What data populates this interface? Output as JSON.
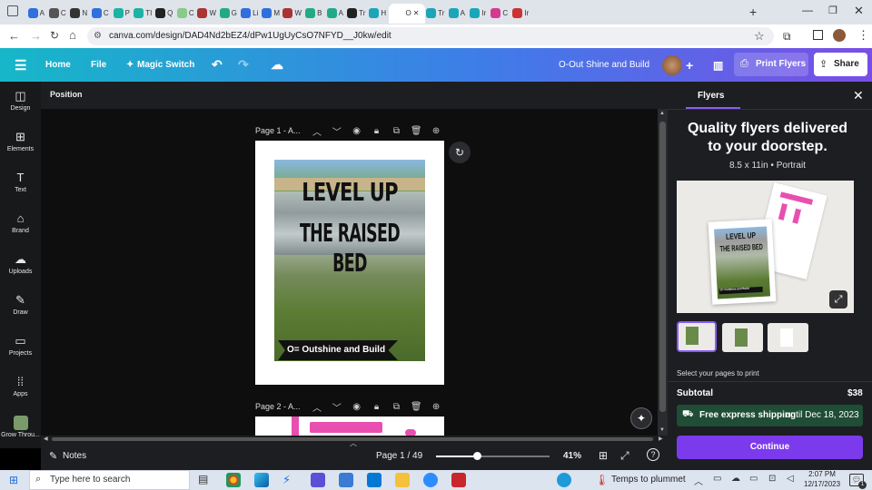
{
  "browser": {
    "tabs": [
      {
        "label": "A",
        "color": "#2f6fde"
      },
      {
        "label": "C",
        "color": "#555"
      },
      {
        "label": "N",
        "color": "#333"
      },
      {
        "label": "C",
        "color": "#2f6fde"
      },
      {
        "label": "P",
        "color": "#1ab3a6"
      },
      {
        "label": "TI",
        "color": "#1ab3a6"
      },
      {
        "label": "Q",
        "color": "#222"
      },
      {
        "label": "C",
        "color": "#8c8"
      },
      {
        "label": "W",
        "color": "#a33"
      },
      {
        "label": "G",
        "color": "#2a8"
      },
      {
        "label": "Li",
        "color": "#2f6fde"
      },
      {
        "label": "M",
        "color": "#2f6fde"
      },
      {
        "label": "W",
        "color": "#a33"
      },
      {
        "label": "B",
        "color": "#2a8"
      },
      {
        "label": "A",
        "color": "#2a8"
      },
      {
        "label": "Tr",
        "color": "#222"
      },
      {
        "label": "H",
        "color": "#1aa6b8"
      },
      {
        "label": "O",
        "color": "#fff"
      },
      {
        "label": "Tr",
        "color": "#1aa6b8"
      },
      {
        "label": "A",
        "color": "#1aa6b8"
      },
      {
        "label": "Ir",
        "color": "#1aa6b8"
      },
      {
        "label": "C",
        "color": "#d63a8e"
      },
      {
        "label": "Ir",
        "color": "#c33"
      }
    ],
    "active_tab_index": 17,
    "url": "canva.com/design/DAD4Nd2bEZ4/dPw1UgUyCsO7NFYD__J0kw/edit"
  },
  "canva": {
    "home": "Home",
    "file": "File",
    "magic_switch": "Magic Switch",
    "title": "O-Out Shine and Build",
    "print_flyers": "Print Flyers",
    "share": "Share",
    "position": "Position",
    "nav": [
      {
        "label": "Design",
        "icon": "◫"
      },
      {
        "label": "Elements",
        "icon": "⊞"
      },
      {
        "label": "Text",
        "icon": "T"
      },
      {
        "label": "Brand",
        "icon": "⌂"
      },
      {
        "label": "Uploads",
        "icon": "☁"
      },
      {
        "label": "Draw",
        "icon": "✎"
      },
      {
        "label": "Projects",
        "icon": "▭"
      },
      {
        "label": "Apps",
        "icon": "⁞⁞"
      },
      {
        "label": "Grow Throu..."
      }
    ],
    "page1_label": "Page 1 - A...",
    "page2_label": "Page 2 - A...",
    "design_line1": "LEVEL UP",
    "design_line2": "THE RAISED BED",
    "design_banner": "O= Outshine and Build",
    "notes": "Notes",
    "page_count": "Page 1 / 49",
    "zoom": "41%",
    "zoom_slider_fraction": 0.36
  },
  "panel": {
    "tab": "Flyers",
    "headline": "Quality flyers delivered to your doorstep.",
    "subhead": "8.5 x 11in • Portrait",
    "preview_line1": "LEVEL UP",
    "preview_line2": "THE RAISED BED",
    "preview_banner": "O= Outshine and Build",
    "select_pages": "Select your pages to print",
    "subtotal_label": "Subtotal",
    "subtotal_value": "$38",
    "shipping_bold": "Free express shipping",
    "shipping_rest": "until Dec 18, 2023",
    "continue": "Continue"
  },
  "taskbar": {
    "search_placeholder": "Type here to search",
    "weather": "Temps to plummet",
    "time": "2:07 PM",
    "date": "12/17/2023",
    "notif_count": "1"
  }
}
